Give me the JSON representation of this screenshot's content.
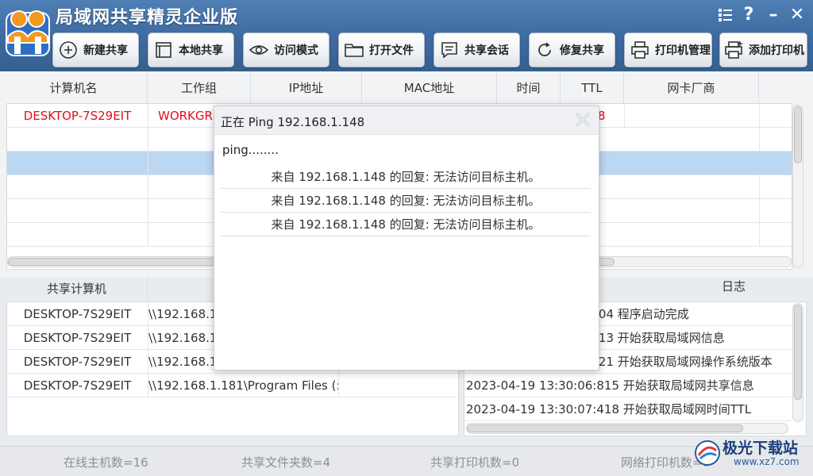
{
  "app": {
    "title": "局域网共享精灵企业版"
  },
  "window_controls": [
    {
      "name": "menu-icon",
      "glyph": "☰"
    },
    {
      "name": "help-icon",
      "glyph": "?"
    },
    {
      "name": "minimize-icon",
      "glyph": "–"
    },
    {
      "name": "close-icon",
      "glyph": "✕"
    }
  ],
  "toolbar": [
    {
      "label": "新建共享",
      "icon": "plus-circle-icon"
    },
    {
      "label": "本地共享",
      "icon": "window-icon"
    },
    {
      "label": "访问模式",
      "icon": "eye-icon"
    },
    {
      "label": "打开文件",
      "icon": "folder-icon"
    },
    {
      "label": "共享会话",
      "icon": "chat-icon"
    },
    {
      "label": "修复共享",
      "icon": "refresh-icon"
    },
    {
      "label": "打印机管理",
      "icon": "printer-icon"
    },
    {
      "label": "添加打印机",
      "icon": "add-printer-icon"
    }
  ],
  "hosts_table": {
    "columns": [
      "计算机名",
      "工作组",
      "IP地址",
      "MAC地址",
      "时间",
      "TTL",
      "网卡厂商"
    ],
    "rows": [
      {
        "name": "DESKTOP-7S29EIT",
        "workgroup": "WORKGR",
        "ttl": "8",
        "highlight": "red"
      }
    ],
    "selected_row": 3
  },
  "shared_computers": {
    "header": "共享计算机",
    "rows": [
      {
        "name": "DESKTOP-7S29EIT",
        "path": "\\\\192.168.1"
      },
      {
        "name": "DESKTOP-7S29EIT",
        "path": "\\\\192.168.1"
      },
      {
        "name": "DESKTOP-7S29EIT",
        "path": "\\\\192.168.1"
      },
      {
        "name": "DESKTOP-7S29EIT",
        "path": "\\\\192.168.1.181\\Program Files (:"
      }
    ]
  },
  "log": {
    "header": "日志",
    "rows": [
      {
        "time": "04",
        "msg": "程序启动完成"
      },
      {
        "time": "13",
        "msg": "开始获取局域网信息"
      },
      {
        "time": "21",
        "msg": "开始获取局域网操作系统版本"
      },
      {
        "time": "2023-04-19 13:30:06:815",
        "msg": "开始获取局域网共享信息"
      },
      {
        "time": "2023-04-19 13:30:07:418",
        "msg": "开始获取局域网时间TTL"
      }
    ]
  },
  "status": {
    "online_hosts": "在线主机数=16",
    "shared_folders": "共享文件夹数=4",
    "shared_printers": "共享打印机数=0",
    "network_printers": "网络打印机数=0"
  },
  "ping_dialog": {
    "title": "正在 Ping 192.168.1.148",
    "status": "ping........",
    "replies": [
      "来自 192.168.1.148 的回复: 无法访问目标主机。",
      "来自 192.168.1.148 的回复: 无法访问目标主机。",
      "来自 192.168.1.148 的回复: 无法访问目标主机。"
    ]
  },
  "watermark": {
    "text": "极光下载站",
    "url": "www.xz7.com"
  },
  "colors": {
    "title_bar": "#3d6aa0",
    "selection": "#bcd7f2",
    "alert_red": "#e0101a"
  }
}
